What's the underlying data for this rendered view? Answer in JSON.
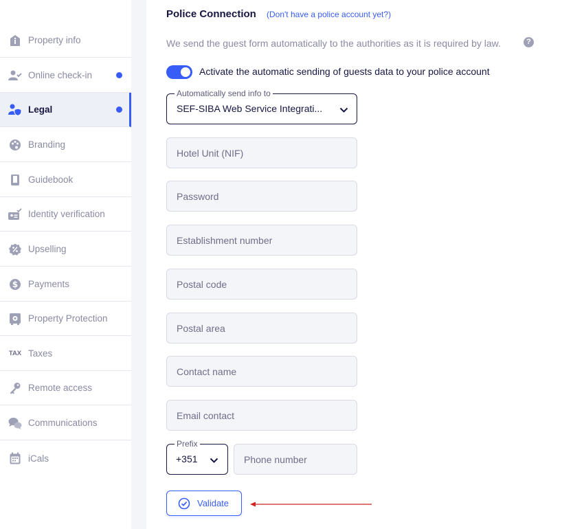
{
  "sidebar": {
    "items": [
      {
        "label": "Property info",
        "icon": "info-icon",
        "dot": false,
        "active": false
      },
      {
        "label": "Online check-in",
        "icon": "user-check-icon",
        "dot": true,
        "active": false
      },
      {
        "label": "Legal",
        "icon": "legal-shield-icon",
        "dot": true,
        "active": true
      },
      {
        "label": "Branding",
        "icon": "palette-icon",
        "dot": false,
        "active": false
      },
      {
        "label": "Guidebook",
        "icon": "book-icon",
        "dot": false,
        "active": false
      },
      {
        "label": "Identity verification",
        "icon": "id-card-icon",
        "dot": false,
        "active": false
      },
      {
        "label": "Upselling",
        "icon": "percent-badge-icon",
        "dot": false,
        "active": false
      },
      {
        "label": "Payments",
        "icon": "dollar-icon",
        "dot": false,
        "active": false
      },
      {
        "label": "Property Protection",
        "icon": "safe-icon",
        "dot": false,
        "active": false
      },
      {
        "label": "Taxes",
        "icon": "tax-icon",
        "icon_text": "TAX",
        "dot": false,
        "active": false
      },
      {
        "label": "Remote access",
        "icon": "key-icon",
        "dot": false,
        "active": false
      },
      {
        "label": "Communications",
        "icon": "chat-icon",
        "dot": false,
        "active": false
      },
      {
        "label": "iCals",
        "icon": "calendar-icon",
        "dot": false,
        "active": false
      }
    ]
  },
  "colors": {
    "accent": "#385cf8",
    "text": "#161643",
    "muted": "#8a8aa3",
    "field_bg": "#f4f5f9"
  },
  "main": {
    "title": "Police Connection",
    "title_link": "(Don't have a police account yet?)",
    "description": "We send the guest form automatically to the authorities as it is required by law.",
    "help_icon": "?",
    "toggle_label": "Activate the automatic sending of guests data to your police account",
    "toggle_on": true,
    "send_select": {
      "legend": "Automatically send info to",
      "value": "SEF-SIBA Web Service Integrati..."
    },
    "fields": [
      {
        "name": "hotel-unit-input",
        "placeholder": "Hotel Unit (NIF)"
      },
      {
        "name": "password-input",
        "placeholder": "Password"
      },
      {
        "name": "establishment-number-input",
        "placeholder": "Establishment number"
      },
      {
        "name": "postal-code-input",
        "placeholder": "Postal code"
      },
      {
        "name": "postal-area-input",
        "placeholder": "Postal area"
      },
      {
        "name": "contact-name-input",
        "placeholder": "Contact name"
      },
      {
        "name": "email-contact-input",
        "placeholder": "Email contact"
      }
    ],
    "prefix": {
      "legend": "Prefix",
      "value": "+351"
    },
    "phone_placeholder": "Phone number",
    "validate_label": "Validate"
  }
}
